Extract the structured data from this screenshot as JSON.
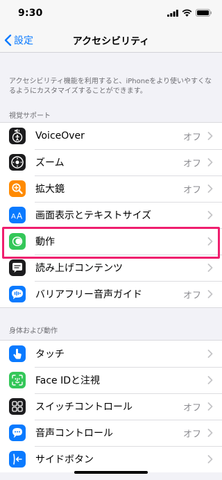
{
  "status_bar": {
    "time": "9:30"
  },
  "nav": {
    "back_label": "設定",
    "title": "アクセシビリティ"
  },
  "description": "アクセシビリティ機能を利用すると、iPhoneをより使いやすくなるようにカスタマイズすることができます。",
  "sections": [
    {
      "header": "視覚サポート",
      "items": [
        {
          "label": "VoiceOver",
          "value": "オフ",
          "icon": "voiceover-icon",
          "color": "#1c1c1e"
        },
        {
          "label": "ズーム",
          "value": "オフ",
          "icon": "zoom-icon",
          "color": "#1c1c1e"
        },
        {
          "label": "拡大鏡",
          "value": "オフ",
          "icon": "magnifier-icon",
          "color": "#ff8a00"
        },
        {
          "label": "画面表示とテキストサイズ",
          "value": "",
          "icon": "text-size-icon",
          "color": "#0a7aff"
        },
        {
          "label": "動作",
          "value": "",
          "icon": "motion-icon",
          "color": "#34c759"
        },
        {
          "label": "読み上げコンテンツ",
          "value": "",
          "icon": "spoken-content-icon",
          "color": "#1c1c1e"
        },
        {
          "label": "バリアフリー音声ガイド",
          "value": "オフ",
          "icon": "audio-descriptions-icon",
          "color": "#0a7aff"
        }
      ]
    },
    {
      "header": "身体および動作",
      "items": [
        {
          "label": "タッチ",
          "value": "",
          "icon": "touch-icon",
          "color": "#0a7aff"
        },
        {
          "label": "Face IDと注視",
          "value": "",
          "icon": "face-id-icon",
          "color": "#34c759"
        },
        {
          "label": "スイッチコントロール",
          "value": "オフ",
          "icon": "switch-control-icon",
          "color": "#1c1c1e"
        },
        {
          "label": "音声コントロール",
          "value": "オフ",
          "icon": "voice-control-icon",
          "color": "#0a7aff"
        },
        {
          "label": "サイドボタン",
          "value": "",
          "icon": "side-button-icon",
          "color": "#0a7aff"
        }
      ]
    }
  ],
  "colors": {
    "accent": "#0a7aff",
    "highlight": "#ef1e6e",
    "background": "#f2f2f7"
  }
}
